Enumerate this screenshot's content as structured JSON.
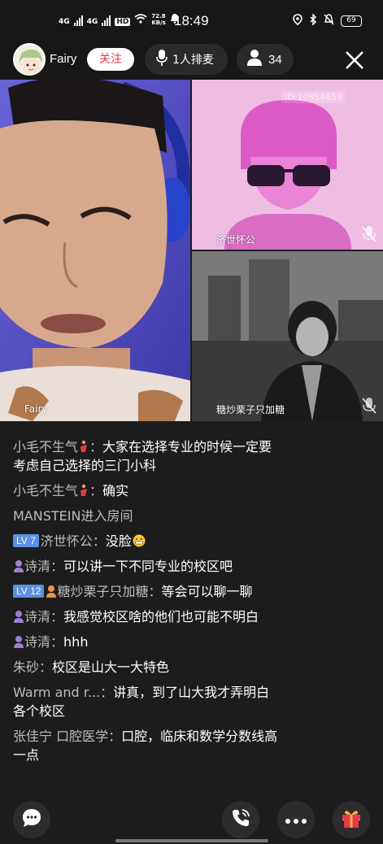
{
  "status_bar": {
    "network_1": "4G",
    "network_2": "4G",
    "hd_label": "HD",
    "speed_value": "72.8",
    "speed_unit": "KB/s",
    "time": "18:49",
    "battery": "69"
  },
  "header": {
    "host_name": "Fairy",
    "follow_label": "关注",
    "queue_label": "1人排麦",
    "viewer_count": "34"
  },
  "video": {
    "main_label": "Fairy",
    "tile_a_label": "济世怀公",
    "tile_b_label": "糖炒栗子只加糖",
    "room_id": "ID:10854659"
  },
  "chat": {
    "messages": [
      {
        "nick": "小毛不生气",
        "sep": "：",
        "text": "大家在选择专业的时候一定要考虑自己选择的三门小科"
      },
      {
        "nick": "小毛不生气",
        "sep": "：",
        "text": "确实"
      },
      {
        "nick": "",
        "sep": "",
        "text": "MANSTEIN进入房间"
      },
      {
        "level": "LV 7",
        "nick": "济世怀公",
        "sep": "：",
        "text": "没脸"
      },
      {
        "nick": "诗清",
        "sep": "：",
        "text": "可以讲一下不同专业的校区吧"
      },
      {
        "level": "LV 12",
        "nick": "糖炒栗子只加糖",
        "sep": "：",
        "text": "等会可以聊一聊"
      },
      {
        "nick": "诗清",
        "sep": "：",
        "text": "我感觉校区啥的他们也可能不明白"
      },
      {
        "nick": "诗清",
        "sep": "：",
        "text": "hhh"
      },
      {
        "nick": "朱砂",
        "sep": "：",
        "text": "校区是山大一大特色"
      },
      {
        "nick": "Warm and r...",
        "sep": "：",
        "text": "讲真，到了山大我才弄明白各个校区"
      },
      {
        "nick": "张佳宁 口腔医学",
        "sep": "：",
        "text": "口腔，临床和数学分数线高一点"
      }
    ]
  },
  "icons": {
    "chat": "chat-bubble-icon",
    "call": "phone-call-icon",
    "more": "more-dots-icon",
    "gift": "gift-icon"
  },
  "colors": {
    "follow_text": "#e8364a",
    "level_badge": "#5b8fe0",
    "gift_red": "#e8364a"
  }
}
